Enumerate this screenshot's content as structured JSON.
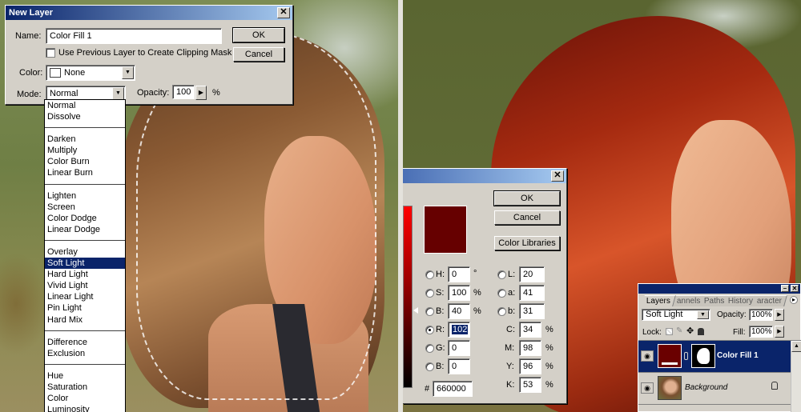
{
  "new_layer_dialog": {
    "title": "New Layer",
    "close_glyph": "✕",
    "name_label": "Name:",
    "name_value": "Color Fill 1",
    "clipping_mask_label": "Use Previous Layer to Create Clipping Mask",
    "clipping_mask_checked": false,
    "color_label": "Color:",
    "color_value": "None",
    "mode_label": "Mode:",
    "mode_value": "Normal",
    "opacity_label": "Opacity:",
    "opacity_value": "100",
    "opacity_unit": "%",
    "ok_label": "OK",
    "cancel_label": "Cancel",
    "arrow_down_glyph": "▼",
    "arrow_right_glyph": "▶"
  },
  "mode_dropdown": {
    "groups": [
      [
        "Normal",
        "Dissolve"
      ],
      [
        "Darken",
        "Multiply",
        "Color Burn",
        "Linear Burn"
      ],
      [
        "Lighten",
        "Screen",
        "Color Dodge",
        "Linear Dodge"
      ],
      [
        "Overlay",
        "Soft Light",
        "Hard Light",
        "Vivid Light",
        "Linear Light",
        "Pin Light",
        "Hard Mix"
      ],
      [
        "Difference",
        "Exclusion"
      ],
      [
        "Hue",
        "Saturation",
        "Color",
        "Luminosity"
      ]
    ],
    "selected": "Soft Light"
  },
  "color_picker": {
    "close_glyph": "✕",
    "ok_label": "OK",
    "cancel_label": "Cancel",
    "color_libraries_label": "Color Libraries",
    "current_color": "#660000",
    "hsb": [
      {
        "label": "H:",
        "value": "0",
        "unit": "°",
        "checked": false
      },
      {
        "label": "S:",
        "value": "100",
        "unit": "%",
        "checked": false
      },
      {
        "label": "B:",
        "value": "40",
        "unit": "%",
        "checked": false
      }
    ],
    "rgb": [
      {
        "label": "R:",
        "value": "102",
        "checked": true
      },
      {
        "label": "G:",
        "value": "0",
        "checked": false
      },
      {
        "label": "B:",
        "value": "0",
        "checked": false
      }
    ],
    "lab": [
      {
        "label": "L:",
        "value": "20"
      },
      {
        "label": "a:",
        "value": "41"
      },
      {
        "label": "b:",
        "value": "31"
      }
    ],
    "cmyk": [
      {
        "label": "C:",
        "value": "34",
        "unit": "%"
      },
      {
        "label": "M:",
        "value": "98",
        "unit": "%"
      },
      {
        "label": "Y:",
        "value": "96",
        "unit": "%"
      },
      {
        "label": "K:",
        "value": "53",
        "unit": "%"
      }
    ],
    "hex_label": "#",
    "hex_value": "660000"
  },
  "layers_panel": {
    "tabs": [
      "Layers",
      "annels",
      "Paths",
      "History",
      "aracter"
    ],
    "active_tab": "Layers",
    "blend_mode": "Soft Light",
    "opacity_label": "Opacity:",
    "opacity_value": "100%",
    "lock_label": "Lock:",
    "fill_label": "Fill:",
    "fill_value": "100%",
    "layers": [
      {
        "name": "Color Fill 1",
        "selected": true,
        "fill_color": "#6a0000"
      },
      {
        "name": "Background",
        "selected": false,
        "locked": true
      }
    ],
    "eye_glyph": "◉",
    "lock_glyph": "🔒",
    "menu_glyph": "▸",
    "minimize_glyph": "–",
    "close_glyph": "✕"
  }
}
